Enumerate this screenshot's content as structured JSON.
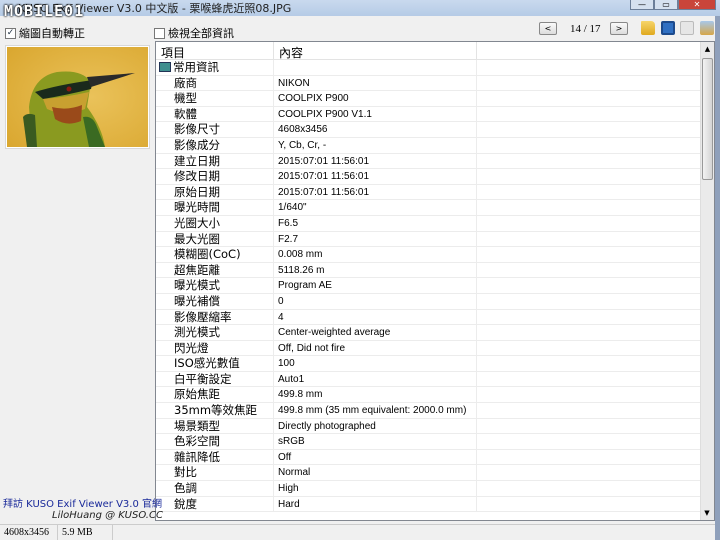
{
  "window": {
    "title": "KUSO Exif Viewer V3.0 中文版 - 栗喉蜂虎近照08.JPG",
    "watermark": "MOBILE01",
    "minimize": "—",
    "maximize": "▭",
    "close": "✕"
  },
  "toolbar": {
    "auto_rotate_label": "縮圖自動轉正",
    "auto_rotate_checked": true,
    "show_all_label": "檢視全部資訊",
    "show_all_checked": false,
    "prev": "<",
    "next": ">",
    "counter": "14 / 17",
    "icons": [
      "open-folder-icon",
      "save-icon",
      "search-icon",
      "settings-icon"
    ]
  },
  "table": {
    "headers": [
      "項目",
      "內容"
    ],
    "group": "常用資訊",
    "rows": [
      {
        "k": "廠商",
        "v": "NIKON"
      },
      {
        "k": "機型",
        "v": "COOLPIX P900"
      },
      {
        "k": "軟體",
        "v": "COOLPIX P900   V1.1"
      },
      {
        "k": "影像尺寸",
        "v": "4608x3456"
      },
      {
        "k": "影像成分",
        "v": "Y, Cb, Cr, -"
      },
      {
        "k": "建立日期",
        "v": "2015:07:01 11:56:01"
      },
      {
        "k": "修改日期",
        "v": "2015:07:01 11:56:01"
      },
      {
        "k": "原始日期",
        "v": "2015:07:01 11:56:01"
      },
      {
        "k": "曝光時間",
        "v": "1/640\""
      },
      {
        "k": "光圈大小",
        "v": "F6.5"
      },
      {
        "k": "最大光圈",
        "v": "F2.7"
      },
      {
        "k": "模糊圈(CoC)",
        "v": "0.008 mm"
      },
      {
        "k": "超焦距離",
        "v": "5118.26 m"
      },
      {
        "k": "曝光模式",
        "v": "Program AE"
      },
      {
        "k": "曝光補償",
        "v": "0"
      },
      {
        "k": "影像壓縮率",
        "v": "4"
      },
      {
        "k": "測光模式",
        "v": "Center-weighted average"
      },
      {
        "k": "閃光燈",
        "v": "Off, Did not fire"
      },
      {
        "k": "ISO感光數值",
        "v": "100"
      },
      {
        "k": "白平衡設定",
        "v": "Auto1"
      },
      {
        "k": "原始焦距",
        "v": "499.8 mm"
      },
      {
        "k": "35mm等效焦距",
        "v": "499.8 mm (35 mm equivalent: 2000.0 mm)"
      },
      {
        "k": "場景類型",
        "v": "Directly photographed"
      },
      {
        "k": "色彩空間",
        "v": "sRGB"
      },
      {
        "k": "雜訊降低",
        "v": "Off"
      },
      {
        "k": "對比",
        "v": "Normal"
      },
      {
        "k": "色調",
        "v": "High"
      },
      {
        "k": "銳度",
        "v": "Hard"
      }
    ]
  },
  "sidebar": {
    "link": "拜訪 KUSO Exif Viewer V3.0 官網",
    "author": "LiloHuang @ KUSO.CC"
  },
  "status": {
    "dimensions": "4608x3456",
    "size": "5.9 MB"
  }
}
